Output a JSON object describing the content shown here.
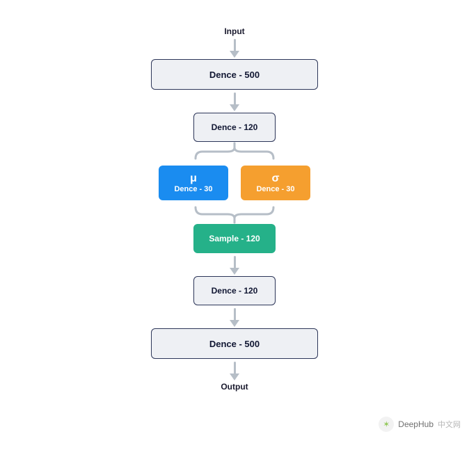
{
  "input_label": "Input",
  "output_label": "Output",
  "boxes": {
    "dence500a": "Dence - 500",
    "dence120a": "Dence - 120",
    "mu_symbol": "μ",
    "mu_label": "Dence - 30",
    "sigma_symbol": "σ",
    "sigma_label": "Dence - 30",
    "sample": "Sample - 120",
    "dence120b": "Dence - 120",
    "dence500b": "Dence - 500"
  },
  "colors": {
    "box_bg": "#eef0f4",
    "box_border": "#2c3558",
    "blue": "#1a8cf0",
    "orange": "#f59f2f",
    "green": "#25b189",
    "arrow": "#b6bec7"
  },
  "watermark": {
    "brand": "DeepHub",
    "suffix": "中文网"
  }
}
